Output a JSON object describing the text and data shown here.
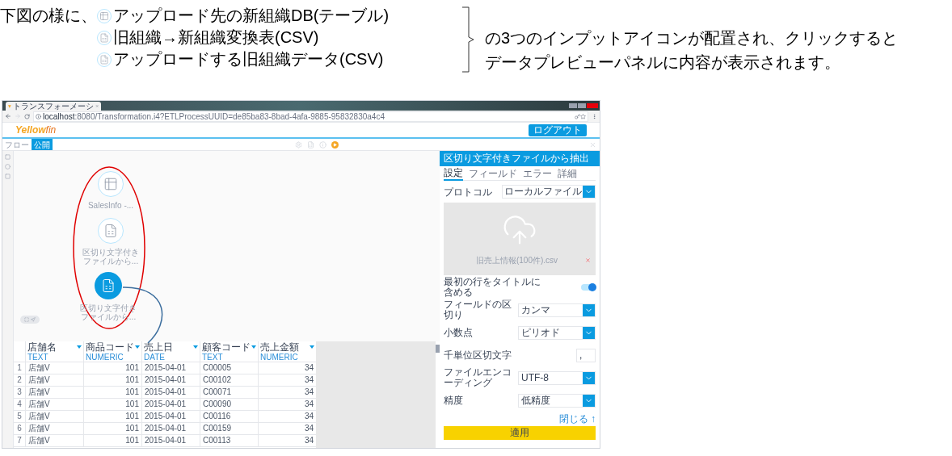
{
  "annotation": {
    "lead": "下図の様に、",
    "items": [
      {
        "kind": "table",
        "label": "アップロード先の新組織DB(テーブル)"
      },
      {
        "kind": "file",
        "label": "旧組織→新組織変換表(CSV)"
      },
      {
        "kind": "file",
        "label": "アップロードする旧組織データ(CSV)"
      }
    ],
    "note_lines": [
      "の3つのインプットアイコンが配置され、クリックすると",
      "データプレビューパネルに内容が表示されます。"
    ]
  },
  "browser": {
    "tab_title": "トランスフォーメーシ",
    "url_host": "localhost",
    "url_rest": ":8080/Transformation.i4?ETLProcessUUID=de85ba83-8bad-4afa-9885-95832830a4c4"
  },
  "app": {
    "logo": {
      "main": "Yellow",
      "accent": "fin"
    },
    "logout": "ログアウト",
    "tabs": [
      {
        "label": "フロー",
        "selected": false
      },
      {
        "label": "公開",
        "selected": true
      }
    ],
    "nodes": [
      {
        "kind": "table",
        "label": "SalesInfo -...",
        "selected": false
      },
      {
        "kind": "file",
        "label": "区切り文字付きファイルから...",
        "selected": false
      },
      {
        "kind": "file",
        "label": "区切り文字付きファイルから...",
        "selected": true
      }
    ],
    "panel": {
      "title": "区切り文字付きファイルから抽出",
      "tabs": [
        {
          "label": "設定",
          "selected": true
        },
        {
          "label": "フィールド",
          "selected": false
        },
        {
          "label": "エラー",
          "selected": false
        },
        {
          "label": "詳細",
          "selected": false
        }
      ],
      "protocol": {
        "label": "プロトコル",
        "value": "ローカルファイル"
      },
      "upload": {
        "file": "旧売上情報(100件).csv"
      },
      "toggle": {
        "label": "最初の行をタイトルに含める",
        "on": true
      },
      "fields": [
        {
          "kind": "select",
          "label": "フィールドの区切り",
          "value": "カンマ"
        },
        {
          "kind": "select",
          "label": "小数点",
          "value": "ピリオド"
        },
        {
          "kind": "input",
          "label": "千単位区切文字",
          "value": ","
        },
        {
          "kind": "select",
          "label": "ファイルエンコーディング",
          "value": "UTF-8"
        },
        {
          "kind": "select",
          "label": "精度",
          "value": "低精度"
        }
      ],
      "close": "閉じる ↑",
      "apply": "適用"
    },
    "table": {
      "columns": [
        {
          "name": "店舗名",
          "type": "TEXT"
        },
        {
          "name": "商品コード",
          "type": "NUMERIC"
        },
        {
          "name": "売上日",
          "type": "DATE"
        },
        {
          "name": "顧客コード",
          "type": "TEXT"
        },
        {
          "name": "売上金額",
          "type": "NUMERIC"
        }
      ],
      "rows": [
        {
          "index": "1",
          "cells": [
            "店舗V",
            "101",
            "2015-04-01",
            "C00005",
            "34"
          ]
        },
        {
          "index": "2",
          "cells": [
            "店舗V",
            "101",
            "2015-04-01",
            "C00102",
            "34"
          ]
        },
        {
          "index": "3",
          "cells": [
            "店舗V",
            "101",
            "2015-04-01",
            "C00071",
            "34"
          ]
        },
        {
          "index": "4",
          "cells": [
            "店舗V",
            "101",
            "2015-04-01",
            "C00090",
            "34"
          ]
        },
        {
          "index": "5",
          "cells": [
            "店舗V",
            "101",
            "2015-04-01",
            "C00116",
            "34"
          ]
        },
        {
          "index": "6",
          "cells": [
            "店舗V",
            "101",
            "2015-04-01",
            "C00159",
            "34"
          ]
        },
        {
          "index": "7",
          "cells": [
            "店舗V",
            "101",
            "2015-04-01",
            "C00113",
            "34"
          ]
        }
      ]
    }
  }
}
